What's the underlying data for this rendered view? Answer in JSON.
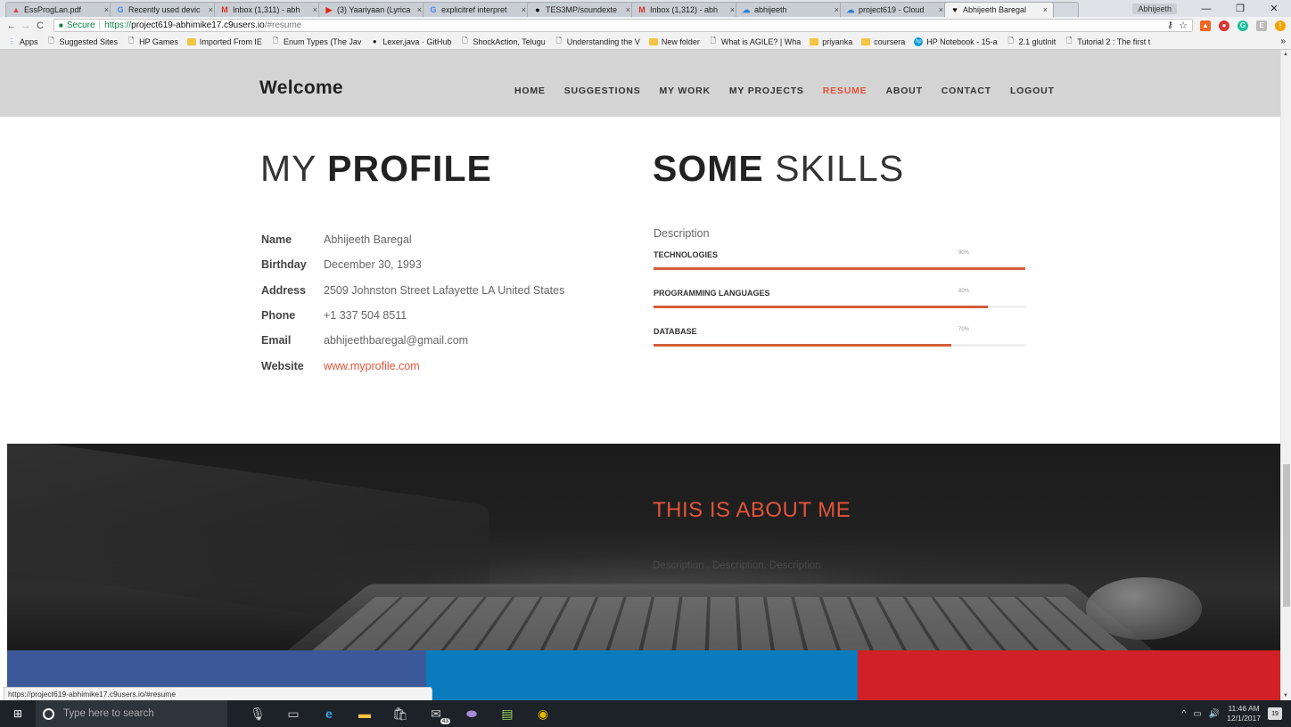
{
  "browser": {
    "tabs": [
      {
        "icon": "pdf-icon",
        "title": "EssProgLan.pdf"
      },
      {
        "icon": "google-icon",
        "title": "Recently used devic"
      },
      {
        "icon": "gmail-icon",
        "title": "Inbox (1,311) - abh"
      },
      {
        "icon": "youtube-icon",
        "title": "(3) Yaariyaan (Lyrica"
      },
      {
        "icon": "google-icon",
        "title": "explicitref interpret"
      },
      {
        "icon": "github-icon",
        "title": "TES3MP/soundexte"
      },
      {
        "icon": "gmail-icon",
        "title": "Inbox (1,312) - abh"
      },
      {
        "icon": "cloud9-icon",
        "title": "abhijeeth"
      },
      {
        "icon": "cloud9-icon",
        "title": "project619 - Cloud"
      },
      {
        "icon": "heart-icon",
        "title": "Abhijeeth Baregal"
      }
    ],
    "active_tab": 9,
    "profile_name": "Abhijeeth",
    "address": {
      "secure_label": "Secure",
      "protocol": "https://",
      "host": "project619-abhimike17.c9users.io",
      "hash": "/#resume"
    },
    "bookmarks": [
      {
        "icon": "apps-icon",
        "label": "Apps"
      },
      {
        "icon": "page-icon",
        "label": "Suggested Sites"
      },
      {
        "icon": "page-icon",
        "label": "HP Games"
      },
      {
        "icon": "folder-icon",
        "label": "Imported From IE"
      },
      {
        "icon": "page-icon",
        "label": "Enum Types (The Jav"
      },
      {
        "icon": "github-icon",
        "label": "Lexer.java · GitHub"
      },
      {
        "icon": "page-icon",
        "label": "ShockAction, Telugu"
      },
      {
        "icon": "page-icon",
        "label": "Understanding the V"
      },
      {
        "icon": "folder-icon",
        "label": "New folder"
      },
      {
        "icon": "page-icon",
        "label": "What is AGILE? | Wha"
      },
      {
        "icon": "folder-icon",
        "label": "priyanka"
      },
      {
        "icon": "folder-icon",
        "label": "coursera"
      },
      {
        "icon": "hp-icon",
        "label": "HP Notebook - 15-a"
      },
      {
        "icon": "page-icon",
        "label": "2.1 glutInit"
      },
      {
        "icon": "page-icon",
        "label": "Tutorial 2 : The first t"
      }
    ],
    "more_bookmarks": "»",
    "status_url": "https://project619-abhimike17.c9users.io/#resume"
  },
  "site": {
    "brand": "Welcome",
    "menu": [
      {
        "label": "HOME",
        "active": false
      },
      {
        "label": "SUGGESTIONS",
        "active": false
      },
      {
        "label": "MY WORK",
        "active": false
      },
      {
        "label": "MY PROJECTS",
        "active": false
      },
      {
        "label": "RESUME",
        "active": true
      },
      {
        "label": "ABOUT",
        "active": false
      },
      {
        "label": "CONTACT",
        "active": false
      },
      {
        "label": "LOGOUT",
        "active": false
      }
    ],
    "profile": {
      "title_light": "MY ",
      "title_bold": "PROFILE",
      "rows": [
        {
          "key": "Name",
          "value": "Abhijeeth Baregal",
          "link": false
        },
        {
          "key": "Birthday",
          "value": "December 30, 1993",
          "link": false
        },
        {
          "key": "Address",
          "value": "2509 Johnston Street Lafayette LA United States",
          "link": false
        },
        {
          "key": "Phone",
          "value": "+1 337 504 8511",
          "link": false
        },
        {
          "key": "Email",
          "value": "abhijeethbaregal@gmail.com",
          "link": false
        },
        {
          "key": "Website",
          "value": "www.myprofile.com",
          "link": true
        }
      ]
    },
    "skills": {
      "title_bold": "SOME",
      "title_light": " SKILLS",
      "description": "Description",
      "items": [
        {
          "name": "TECHNOLOGIES",
          "percent_label": "90%",
          "level": 1.0
        },
        {
          "name": "PROGRAMMING LANGUAGES",
          "percent_label": "80%",
          "level": 0.9
        },
        {
          "name": "DATABASE",
          "percent_label": "70%",
          "level": 0.8
        }
      ]
    },
    "about": {
      "title": "THIS IS ABOUT ME",
      "description": "Description . Description. Description"
    },
    "color_bar": [
      "#3b5998",
      "#0a7bbd",
      "#cf2127"
    ]
  },
  "colors": {
    "accent": "#e2543a",
    "skill_bar": "#d45d3c",
    "nav_bg": "#d4d4d4"
  },
  "taskbar": {
    "search_placeholder": "Type here to search",
    "mail_badge": "43",
    "time": "11:46 AM",
    "date": "12/1/2017",
    "notification_count": "19"
  }
}
